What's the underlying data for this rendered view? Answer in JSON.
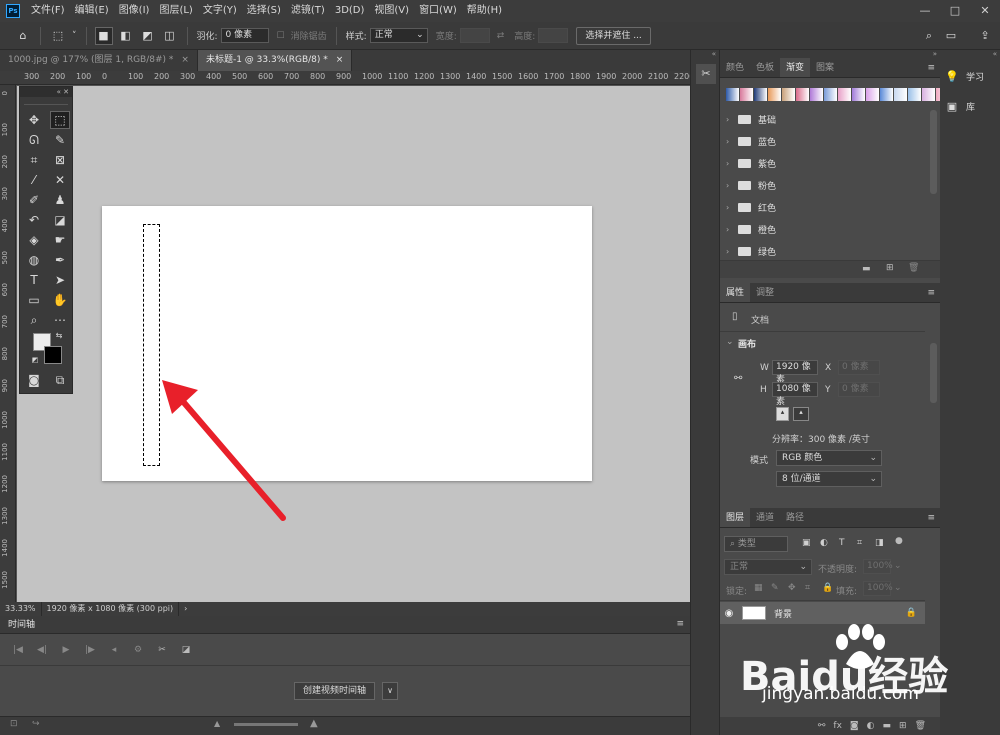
{
  "app": {
    "logo": "Ps"
  },
  "menu": [
    "文件(F)",
    "编辑(E)",
    "图像(I)",
    "图层(L)",
    "文字(Y)",
    "选择(S)",
    "滤镜(T)",
    "3D(D)",
    "视图(V)",
    "窗口(W)",
    "帮助(H)"
  ],
  "window_controls": {
    "minimize": "—",
    "maximize": "□",
    "close": "✕"
  },
  "options": {
    "feather_label": "羽化:",
    "feather_value": "0 像素",
    "antialias_label": "消除锯齿",
    "style_label": "样式:",
    "style_value": "正常",
    "width_label": "宽度:",
    "height_label": "高度:",
    "select_mask_button": "选择并遮住 ..."
  },
  "tabs": [
    {
      "label": "1000.jpg @ 177% (图层 1, RGB/8#) *",
      "close": "×"
    },
    {
      "label": "未标题-1 @ 33.3%(RGB/8) *",
      "close": "×"
    }
  ],
  "ruler_top": [
    "300",
    "200",
    "100",
    "0",
    "100",
    "200",
    "300",
    "400",
    "500",
    "600",
    "700",
    "800",
    "900",
    "1000",
    "1100",
    "1200",
    "1300",
    "1400",
    "1500",
    "1600",
    "1700",
    "1800",
    "1900",
    "2000",
    "2100",
    "2200"
  ],
  "ruler_left": [
    "0",
    "100",
    "200",
    "300",
    "400",
    "500",
    "600",
    "700",
    "800",
    "900",
    "1000",
    "1100",
    "1200",
    "1300",
    "1400",
    "1500"
  ],
  "status": {
    "zoom": "33.33%",
    "doc_size": "1920 像素 x 1080 像素 (300 ppi)",
    "arrow": "›"
  },
  "timeline": {
    "title": "时间轴",
    "create_button": "创建视频时间轴",
    "dropdown": "∨"
  },
  "gradients_panel": {
    "tabs": [
      "颜色",
      "色板",
      "渐变",
      "图案"
    ],
    "folders": [
      "基础",
      "蓝色",
      "紫色",
      "粉色",
      "红色",
      "橙色",
      "绿色"
    ],
    "swatch_colors": [
      "#2e5aa8",
      "#d87a9c",
      "#213a78",
      "#e89a5a",
      "#c8a07a",
      "#d86a8a",
      "#b07ad8",
      "#7a9ad8",
      "#e8a0c8",
      "#a07ad8",
      "#d8a0e8",
      "#5a8ad8",
      "#c8d8f0",
      "#9ac0e8",
      "#d8b0e0",
      "#f0a8c0"
    ]
  },
  "properties_panel": {
    "tabs": [
      "属性",
      "调整"
    ],
    "doc_label": "文档",
    "section": "画布",
    "w_label": "W",
    "w_value": "1920 像素",
    "h_label": "H",
    "h_value": "1080 像素",
    "x_label": "X",
    "x_value": "0 像素",
    "y_label": "Y",
    "y_value": "0 像素",
    "resolution": "分辨率：300 像素 /英寸",
    "mode_label": "模式",
    "mode_value": "RGB 颜色",
    "depth_value": "8 位/通道"
  },
  "layers_panel": {
    "tabs": [
      "图层",
      "通道",
      "路径"
    ],
    "filter_placeholder": "类型",
    "blend_mode": "正常",
    "opacity_label": "不透明度:",
    "opacity_value": "100%",
    "lock_label": "锁定:",
    "fill_label": "填充:",
    "fill_value": "100%",
    "layer_name": "背景"
  },
  "right_strip": {
    "learn": "学习",
    "library": "库"
  },
  "watermark": {
    "brand": "Baidu经验",
    "url": "jingyan.baidu.com"
  },
  "colors": {
    "accent": "#31a8ff",
    "arrow": "#e8202a",
    "canvas": "#ffffff",
    "workarea": "#c3c3c3"
  }
}
